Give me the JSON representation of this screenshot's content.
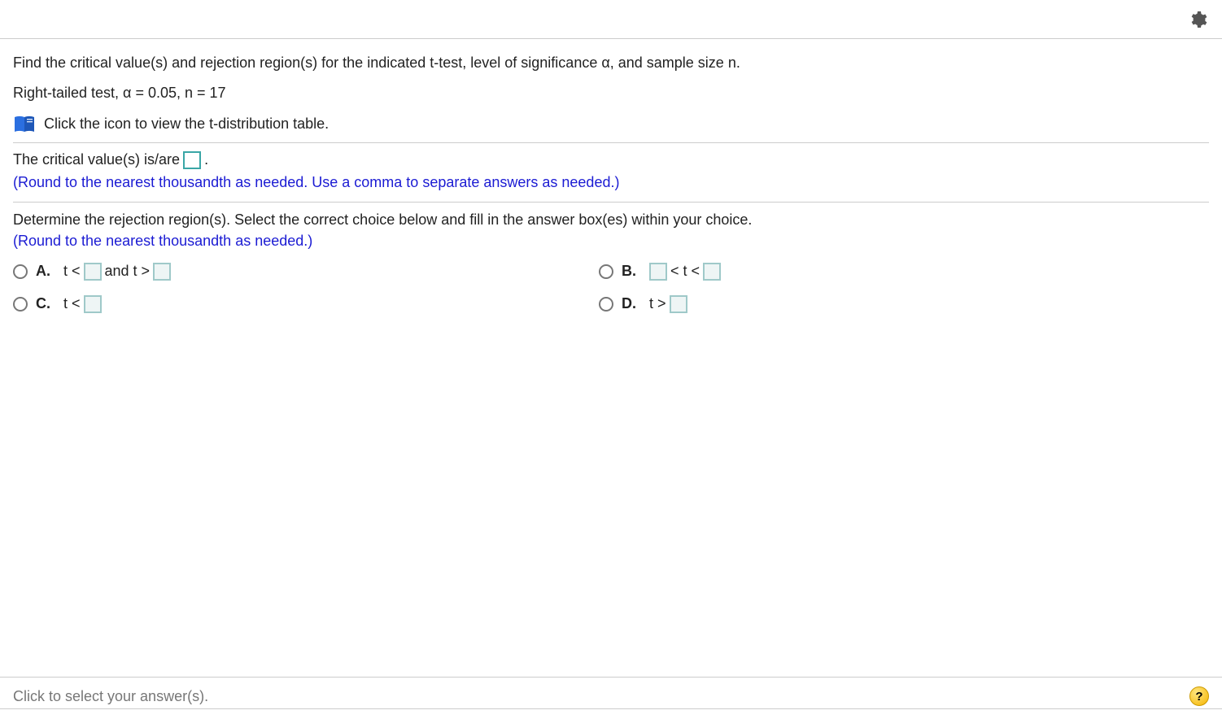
{
  "problem": {
    "statement": "Find the critical value(s) and rejection region(s) for the indicated t-test, level of significance α, and sample size n.",
    "given": "Right-tailed test, α = 0.05, n = 17",
    "table_link_text": "Click the icon to view the t-distribution table."
  },
  "part1": {
    "prefix": "The critical value(s) is/are",
    "suffix": ".",
    "instruction": "(Round to the nearest thousandth as needed. Use a comma to separate answers as needed.)"
  },
  "part2": {
    "prompt": "Determine the rejection region(s). Select the correct choice below and fill in the answer box(es) within your choice.",
    "instruction": "(Round to the nearest thousandth as needed.)",
    "choices": {
      "A": {
        "label": "A.",
        "seg1": "t <",
        "mid": "and t >"
      },
      "B": {
        "label": "B.",
        "mid": "< t <"
      },
      "C": {
        "label": "C.",
        "seg1": "t <"
      },
      "D": {
        "label": "D.",
        "seg1": "t >"
      }
    }
  },
  "footer": {
    "prompt": "Click to select your answer(s).",
    "help": "?"
  }
}
